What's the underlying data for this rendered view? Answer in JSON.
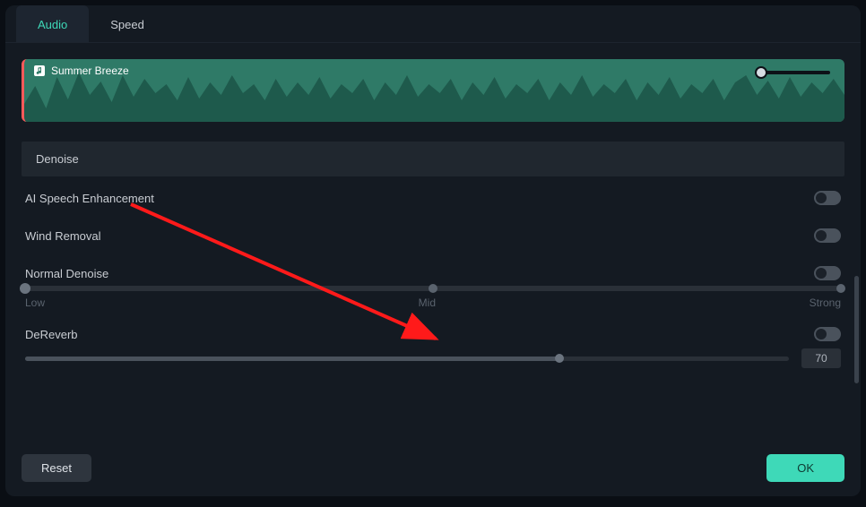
{
  "tabs": {
    "audio": "Audio",
    "speed": "Speed"
  },
  "clip": {
    "name": "Summer Breeze"
  },
  "section": {
    "denoise": "Denoise"
  },
  "controls": {
    "ai_speech": "AI Speech Enhancement",
    "wind_removal": "Wind Removal",
    "normal_denoise": "Normal Denoise",
    "dereverb": "DeReverb"
  },
  "slider_labels": {
    "low": "Low",
    "mid": "Mid",
    "strong": "Strong"
  },
  "dereverb_value": "70",
  "buttons": {
    "reset": "Reset",
    "ok": "OK"
  },
  "toggles": {
    "ai_speech": false,
    "wind_removal": false,
    "normal_denoise": false,
    "dereverb": false
  },
  "colors": {
    "accent": "#3ed9b8",
    "arrow": "#ff1a1a"
  }
}
